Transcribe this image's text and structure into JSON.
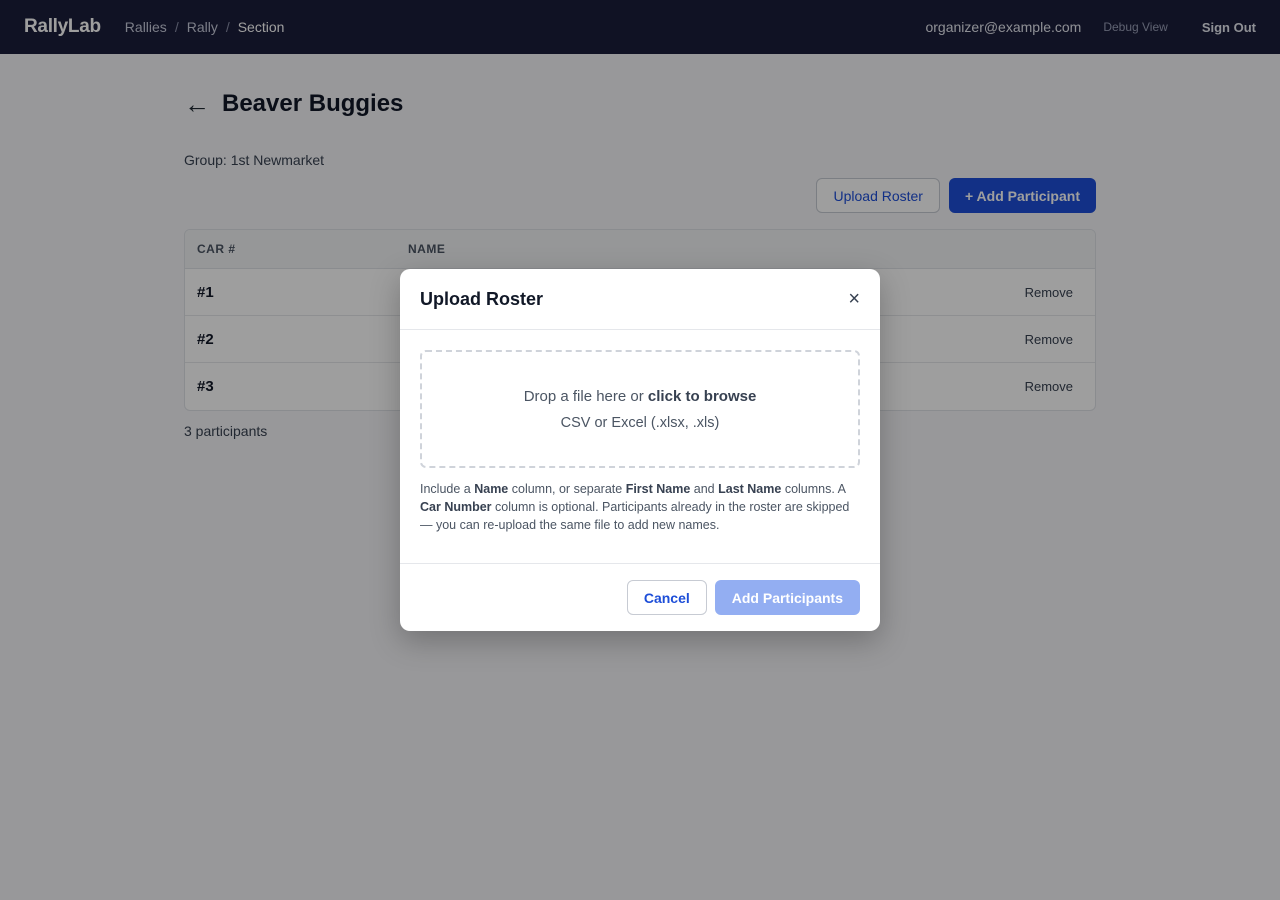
{
  "app": {
    "brand": "RallyLab"
  },
  "breadcrumb": {
    "items": [
      "Rallies",
      "Rally",
      "Section"
    ],
    "separator": "/"
  },
  "header": {
    "user_email": "organizer@example.com",
    "debug_label": "Debug View",
    "signout_label": "Sign Out"
  },
  "page": {
    "back_icon": "←",
    "title": "Beaver Buggies",
    "group_line": "Group: 1st Newmarket",
    "upload_label": "Upload Roster",
    "add_label": "+ Add Participant"
  },
  "table": {
    "columns": [
      "CAR #",
      "NAME"
    ],
    "rows": [
      {
        "car": "#1",
        "name": "",
        "action": "Remove"
      },
      {
        "car": "#2",
        "name": "",
        "action": "Remove"
      },
      {
        "car": "#3",
        "name": "",
        "action": "Remove"
      }
    ],
    "count_label": "3 participants"
  },
  "modal": {
    "title": "Upload Roster",
    "close_icon": "×",
    "drop_prefix": "Drop a file here or ",
    "drop_link": "click to browse",
    "formats": "CSV or Excel (.xlsx, .xls)",
    "help": {
      "t1": "Include a ",
      "b1": "Name",
      "t2": " column, or separate ",
      "b2": "First Name",
      "t3": " and ",
      "b3": "Last Name",
      "t4": " columns. A ",
      "b4": "Car Number",
      "t5": " column is optional. Participants already in the roster are skipped — you can re-upload the same file to add new names."
    },
    "cancel_label": "Cancel",
    "submit_label": "Add Participants"
  },
  "colors": {
    "header_bg": "#1b1d3a",
    "primary": "#1d4ed8",
    "primary_disabled": "#93aef2"
  }
}
